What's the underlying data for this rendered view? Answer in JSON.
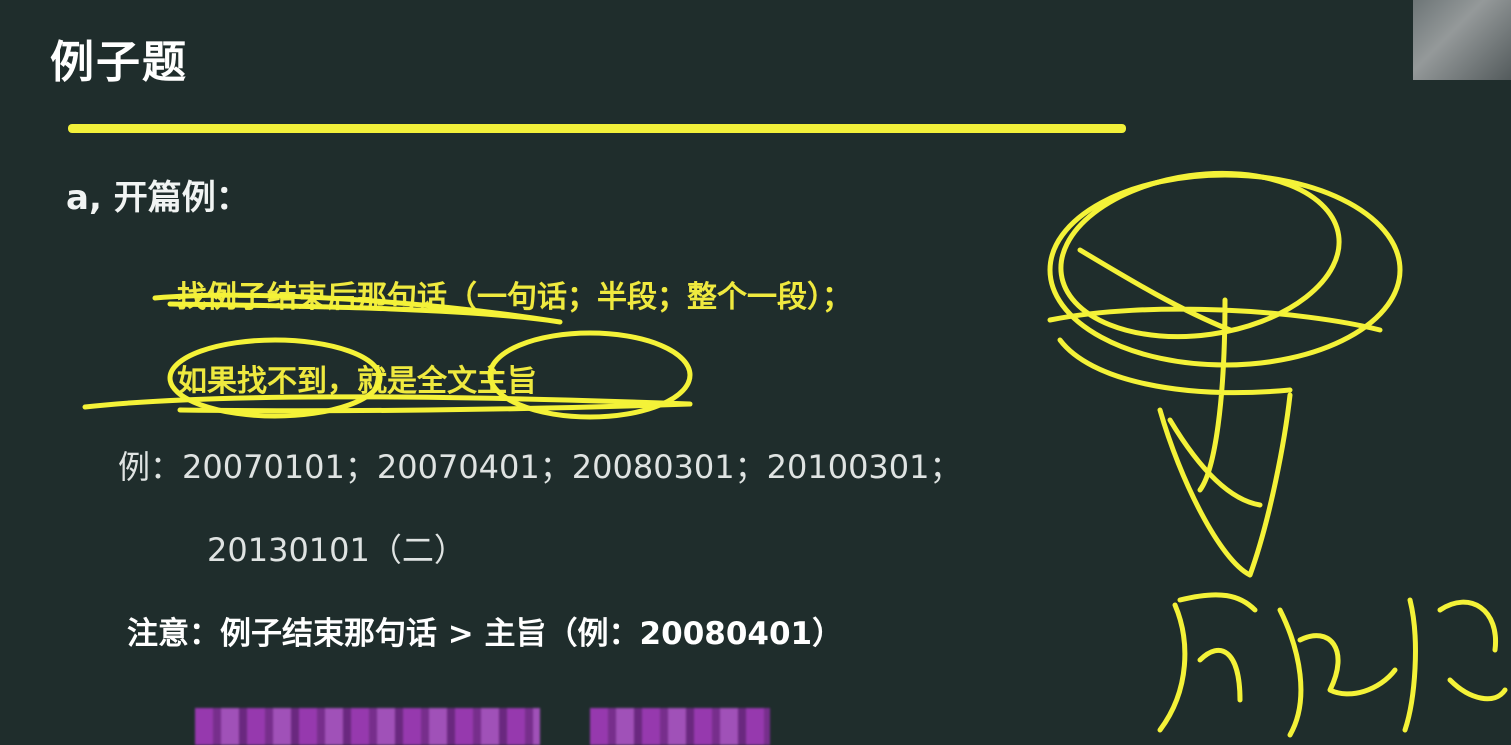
{
  "slide": {
    "title": "例子题",
    "section": "a, 开篇例：",
    "rule_line1": "找例子结束后那句话（一句话；半段；整个一段）；",
    "rule_line2": "如果找不到，就是全文主旨",
    "examples_line1": "例：20070101；20070401；20080301；20100301；",
    "examples_line2": "20130101（二）",
    "note": "注意：例子结束那句话 > 主旨（例：20080401）"
  },
  "colors": {
    "background": "#1f2d2c",
    "accent_yellow": "#f2f03a",
    "text_light": "#ffffff"
  }
}
